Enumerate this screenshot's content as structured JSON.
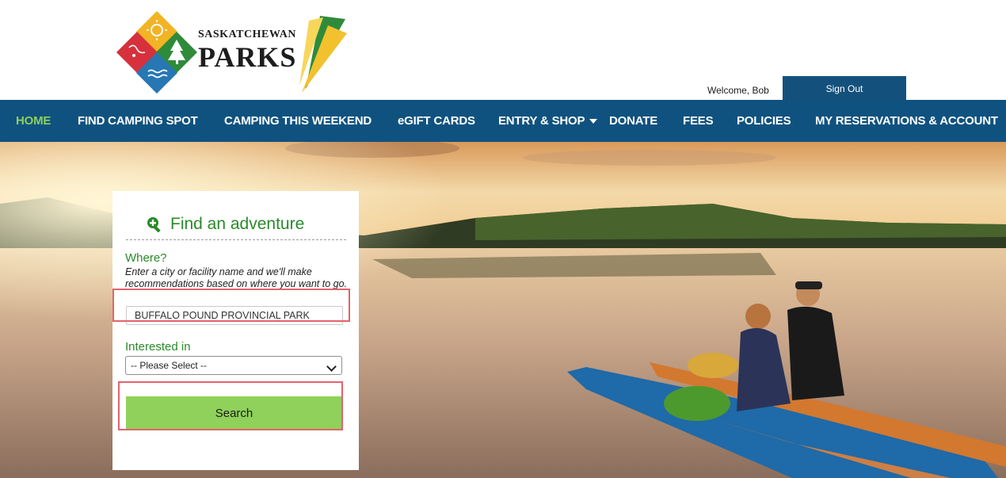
{
  "brand": {
    "line1": "SASKATCHEWAN",
    "line2": "PARKS"
  },
  "user": {
    "welcome": "Welcome, Bob",
    "signout": "Sign Out"
  },
  "nav": {
    "items": [
      {
        "label": "HOME"
      },
      {
        "label": "FIND CAMPING SPOT"
      },
      {
        "label": "CAMPING THIS WEEKEND"
      },
      {
        "label": "eGIFT CARDS"
      },
      {
        "label": "ENTRY & SHOP"
      },
      {
        "label": "DONATE"
      },
      {
        "label": "FEES"
      },
      {
        "label": "POLICIES"
      },
      {
        "label": "MY RESERVATIONS & ACCOUNT"
      }
    ]
  },
  "search": {
    "title": "Find an adventure",
    "where_label": "Where?",
    "where_help": "Enter a city or facility name and we'll make recommendations based on where you want to go.",
    "where_value": "BUFFALO POUND PROVINCIAL PARK",
    "interest_label": "Interested in",
    "interest_selected": "-- Please Select --",
    "button": "Search"
  },
  "colors": {
    "nav_bg": "#10527f",
    "nav_active": "#8cd05a",
    "accent_green": "#2a8a2a",
    "button_green": "#8fd15a",
    "annotation_red": "#e3636b"
  }
}
